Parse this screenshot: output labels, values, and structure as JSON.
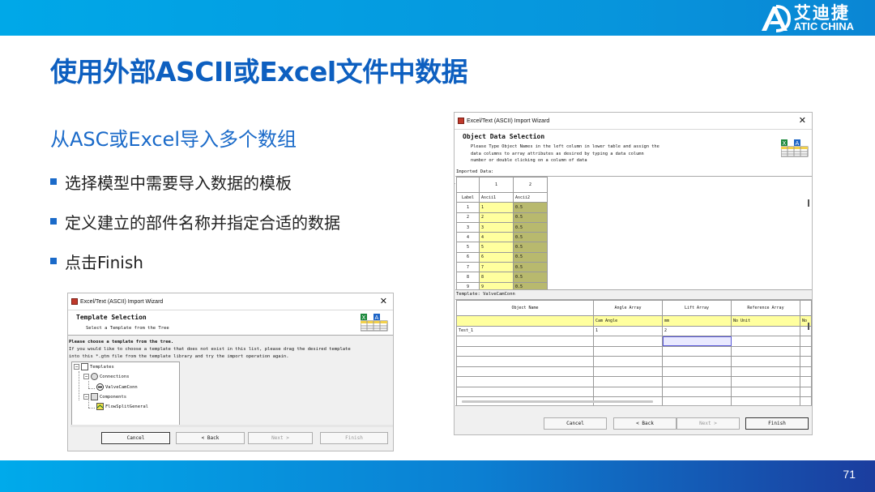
{
  "brand": {
    "cn": "艾迪捷",
    "en": "ATIC CHINA"
  },
  "page": {
    "title": "使用外部ASCII或Excel文件中数据",
    "subtitle": "从ASC或Excel导入多个数组",
    "bullets": [
      "选择模型中需要导入数据的模板",
      "定义建立的部件名称并指定合适的数据",
      "点击Finish"
    ],
    "number": "71"
  },
  "colors": {
    "brand_blue": "#0d5fc0",
    "bar_blue": "#0795dc",
    "grid_yellow": "#ffff9e",
    "grid_olive": "#b8b96e"
  },
  "dialog1": {
    "window_title": "Excel/Text (ASCII) Import Wizard",
    "heading": "Template Selection",
    "description": "Select a Template from the Tree",
    "instruction_bold": "Please choose a template from the tree.",
    "instruction_line1": "If you would like to choose a template that does not exist in this list, please drag the desired template",
    "instruction_line2": "into this *.gtm file from the template library and try the import operation again.",
    "tree": {
      "root": "Templates",
      "connections": "Connections",
      "valve": "ValveCamConn",
      "components": "Components",
      "flowsplit": "FlowSplitGeneral"
    },
    "buttons": {
      "cancel": "Cancel",
      "back": "< Back",
      "next": "Next >",
      "finish": "Finish"
    }
  },
  "dialog2": {
    "window_title": "Excel/Text (ASCII) Import Wizard",
    "heading": "Object Data Selection",
    "desc_line1": "Please Type Object Names in the left column in lower table and assign the",
    "desc_line2": "data columns to array attributes as desired by typing a data column",
    "desc_line3": "number or double clicking on a column of data",
    "imported_label": "Imported Data:",
    "imported": {
      "col_numbers": [
        "1",
        "2"
      ],
      "label_header": "Label",
      "labels": [
        "Ascii1",
        "Ascii2"
      ],
      "rows": [
        [
          "1",
          "1",
          "0.5"
        ],
        [
          "2",
          "2",
          "0.5"
        ],
        [
          "3",
          "3",
          "0.5"
        ],
        [
          "4",
          "4",
          "0.5"
        ],
        [
          "5",
          "5",
          "0.5"
        ],
        [
          "6",
          "6",
          "0.5"
        ],
        [
          "7",
          "7",
          "0.5"
        ],
        [
          "8",
          "8",
          "0.5"
        ],
        [
          "9",
          "9",
          "0.5"
        ]
      ]
    },
    "template_label": "Template: ValveCamConn",
    "template": {
      "headers": [
        "Object Name",
        "Angle Array",
        "Lift Array",
        "Reference Array",
        ""
      ],
      "units": [
        "",
        "Cam Angle",
        "mm",
        "No Unit",
        "No"
      ],
      "rows": [
        [
          "Test_1",
          "1",
          "2",
          "",
          ""
        ]
      ]
    },
    "buttons": {
      "cancel": "Cancel",
      "back": "< Back",
      "next": "Next >",
      "finish": "Finish"
    }
  }
}
